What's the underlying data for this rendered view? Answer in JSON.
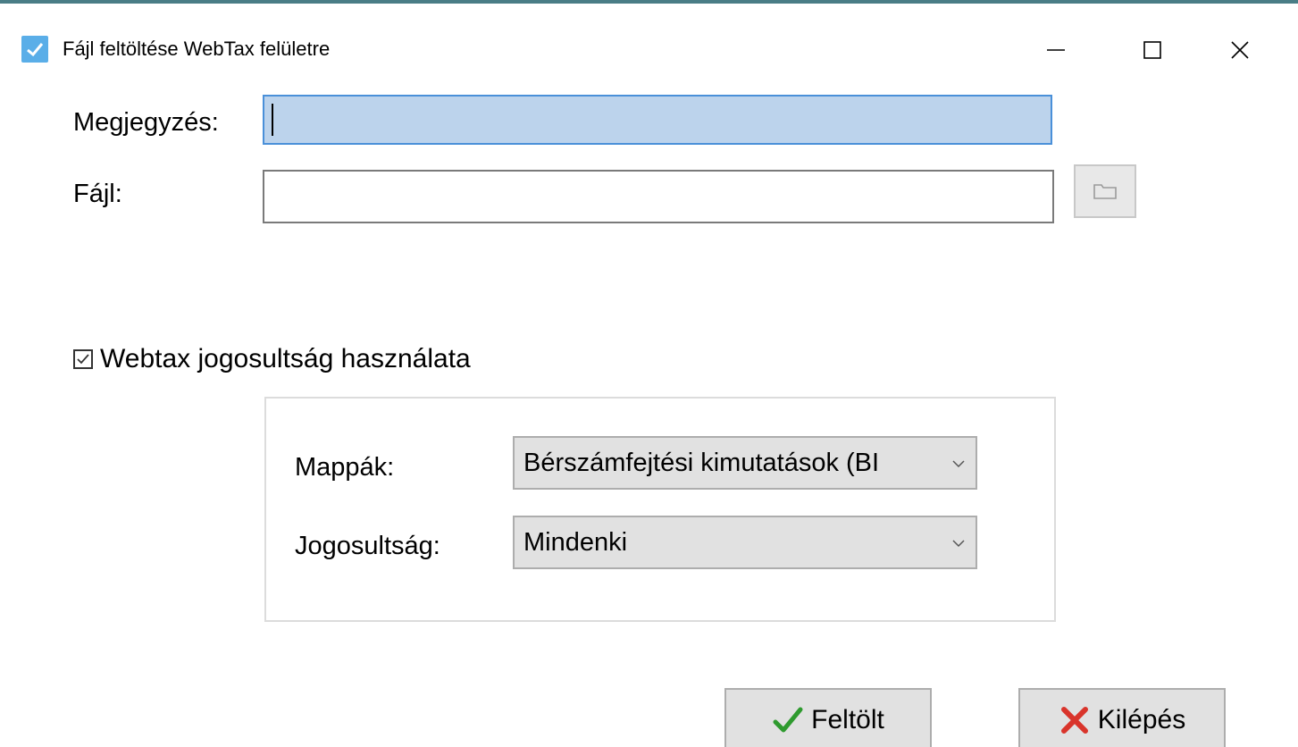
{
  "window": {
    "title": "Fájl feltöltése WebTax felületre",
    "icon": "checkmark-app-icon",
    "controls": {
      "minimize": "minimize-icon",
      "maximize": "maximize-icon",
      "close": "close-icon"
    }
  },
  "form": {
    "note_label": "Megjegyzés:",
    "note_value": "",
    "file_label": "Fájl:",
    "file_value": "",
    "browse_icon": "folder-icon"
  },
  "permission": {
    "checkbox_label": "Webtax jogosultság használata",
    "checked": true,
    "folders_label": "Mappák:",
    "folders_value": "Bérszámfejtési kimutatások (BI",
    "perm_label": "Jogosultság:",
    "perm_value": "Mindenki"
  },
  "actions": {
    "upload_label": "Feltölt",
    "upload_icon": "green-check-icon",
    "exit_label": "Kilépés",
    "exit_icon": "red-x-icon"
  },
  "colors": {
    "titlebar_border": "#4a7d86",
    "focused_input_bg": "#bcd3ec",
    "focused_input_border": "#4a90d9",
    "upload_icon": "#2e9a2e",
    "exit_icon": "#d9342b"
  }
}
